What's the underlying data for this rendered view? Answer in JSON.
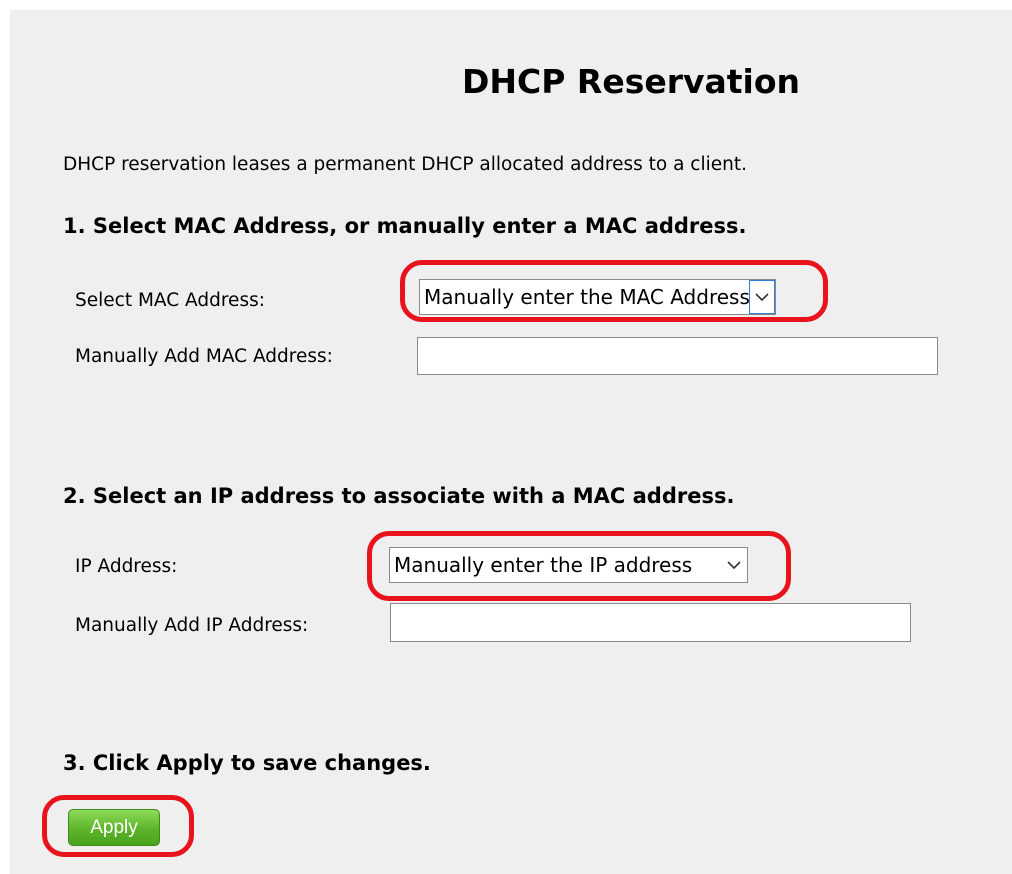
{
  "page": {
    "title": "DHCP Reservation",
    "intro": "DHCP reservation leases a permanent DHCP allocated address to a client."
  },
  "step1": {
    "heading": "1. Select MAC Address, or manually enter a MAC address.",
    "select_label": "Select MAC Address:",
    "select_value": "Manually enter the MAC Address",
    "manual_label": "Manually Add MAC Address:",
    "manual_value": ""
  },
  "step2": {
    "heading": "2. Select an IP address to associate with a MAC address.",
    "select_label": "IP Address:",
    "select_value": "Manually enter the IP address",
    "manual_label": "Manually Add IP Address:",
    "manual_value": ""
  },
  "step3": {
    "heading": "3. Click Apply to save changes.",
    "apply_label": "Apply"
  },
  "colors": {
    "panel_bg": "#efefef",
    "annotation": "#e8131c",
    "apply_button": "#5cb42a",
    "select_focus": "#2f7fd6"
  },
  "icons": {
    "dropdown": "chevron-down-icon"
  }
}
